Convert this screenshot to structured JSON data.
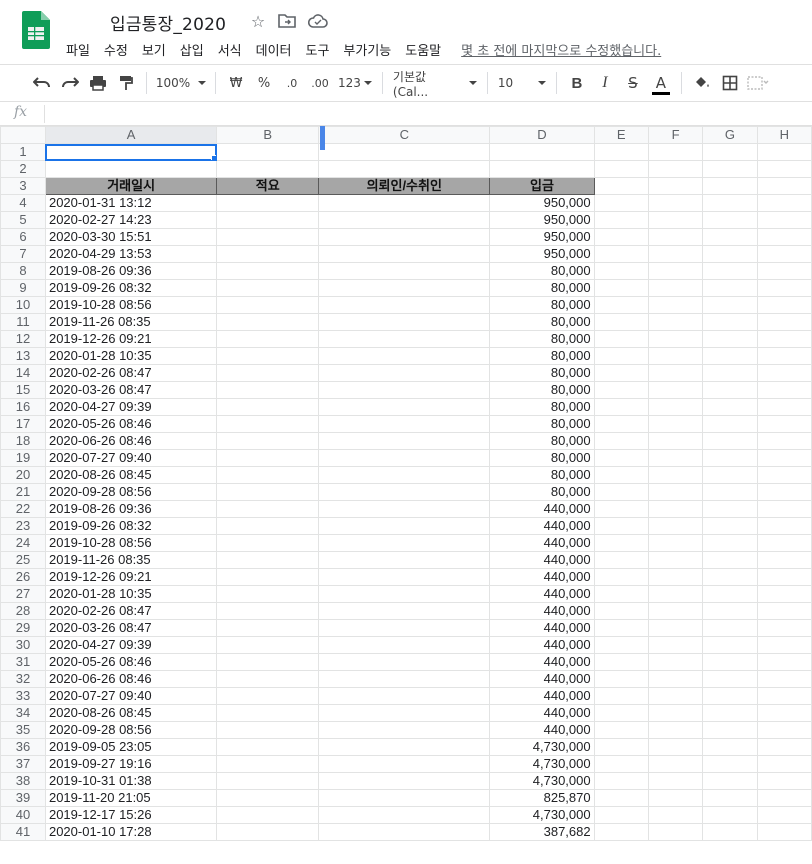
{
  "doc": {
    "title": "입금통장_2020",
    "last_edit": "몇 초 전에 마지막으로 수정했습니다."
  },
  "menu": [
    "파일",
    "수정",
    "보기",
    "삽입",
    "서식",
    "데이터",
    "도구",
    "부가기능",
    "도움말"
  ],
  "toolbar": {
    "zoom": "100%",
    "currency": "₩",
    "percent": "%",
    "dec_decrease": ".0",
    "dec_increase": ".00",
    "format_more": "123",
    "font": "기본값 (Cal...",
    "font_size": "10",
    "bold": "B",
    "italic": "I",
    "strike": "S",
    "text_color": "A"
  },
  "formula_bar": {
    "fx_label": "fx",
    "value": ""
  },
  "columns": [
    "A",
    "B",
    "C",
    "D",
    "E",
    "F",
    "G",
    "H"
  ],
  "table": {
    "headers": [
      "거래일시",
      "적요",
      "의뢰인/수취인",
      "입금"
    ],
    "rows": [
      {
        "date": "2020-01-31 13:12",
        "amount": "950,000"
      },
      {
        "date": "2020-02-27 14:23",
        "amount": "950,000"
      },
      {
        "date": "2020-03-30 15:51",
        "amount": "950,000"
      },
      {
        "date": "2020-04-29 13:53",
        "amount": "950,000"
      },
      {
        "date": "2019-08-26 09:36",
        "amount": "80,000"
      },
      {
        "date": "2019-09-26 08:32",
        "amount": "80,000"
      },
      {
        "date": "2019-10-28 08:56",
        "amount": "80,000"
      },
      {
        "date": "2019-11-26 08:35",
        "amount": "80,000"
      },
      {
        "date": "2019-12-26 09:21",
        "amount": "80,000"
      },
      {
        "date": "2020-01-28 10:35",
        "amount": "80,000"
      },
      {
        "date": "2020-02-26 08:47",
        "amount": "80,000"
      },
      {
        "date": "2020-03-26 08:47",
        "amount": "80,000"
      },
      {
        "date": "2020-04-27 09:39",
        "amount": "80,000"
      },
      {
        "date": "2020-05-26 08:46",
        "amount": "80,000"
      },
      {
        "date": "2020-06-26 08:46",
        "amount": "80,000"
      },
      {
        "date": "2020-07-27 09:40",
        "amount": "80,000"
      },
      {
        "date": "2020-08-26 08:45",
        "amount": "80,000"
      },
      {
        "date": "2020-09-28 08:56",
        "amount": "80,000"
      },
      {
        "date": "2019-08-26 09:36",
        "amount": "440,000"
      },
      {
        "date": "2019-09-26 08:32",
        "amount": "440,000"
      },
      {
        "date": "2019-10-28 08:56",
        "amount": "440,000"
      },
      {
        "date": "2019-11-26 08:35",
        "amount": "440,000"
      },
      {
        "date": "2019-12-26 09:21",
        "amount": "440,000"
      },
      {
        "date": "2020-01-28 10:35",
        "amount": "440,000"
      },
      {
        "date": "2020-02-26 08:47",
        "amount": "440,000"
      },
      {
        "date": "2020-03-26 08:47",
        "amount": "440,000"
      },
      {
        "date": "2020-04-27 09:39",
        "amount": "440,000"
      },
      {
        "date": "2020-05-26 08:46",
        "amount": "440,000"
      },
      {
        "date": "2020-06-26 08:46",
        "amount": "440,000"
      },
      {
        "date": "2020-07-27 09:40",
        "amount": "440,000"
      },
      {
        "date": "2020-08-26 08:45",
        "amount": "440,000"
      },
      {
        "date": "2020-09-28 08:56",
        "amount": "440,000"
      },
      {
        "date": "2019-09-05 23:05",
        "amount": "4,730,000"
      },
      {
        "date": "2019-09-27 19:16",
        "amount": "4,730,000"
      },
      {
        "date": "2019-10-31 01:38",
        "amount": "4,730,000"
      },
      {
        "date": "2019-11-20 21:05",
        "amount": "825,870"
      },
      {
        "date": "2019-12-17 15:26",
        "amount": "4,730,000"
      },
      {
        "date": "2020-01-10 17:28",
        "amount": "387,682"
      }
    ]
  },
  "row_numbers": [
    "1",
    "2",
    "3",
    "4",
    "5",
    "6",
    "7",
    "8",
    "9",
    "10",
    "11",
    "12",
    "13",
    "14",
    "15",
    "16",
    "17",
    "18",
    "19",
    "20",
    "21",
    "22",
    "23",
    "24",
    "25",
    "26",
    "27",
    "28",
    "29",
    "30",
    "31",
    "32",
    "33",
    "34",
    "35",
    "36",
    "37",
    "38",
    "39",
    "40",
    "41"
  ],
  "colors": {
    "sheets_green": "#0f9d58",
    "selection_blue": "#1a73e8",
    "header_fill": "#a6a6a6"
  }
}
